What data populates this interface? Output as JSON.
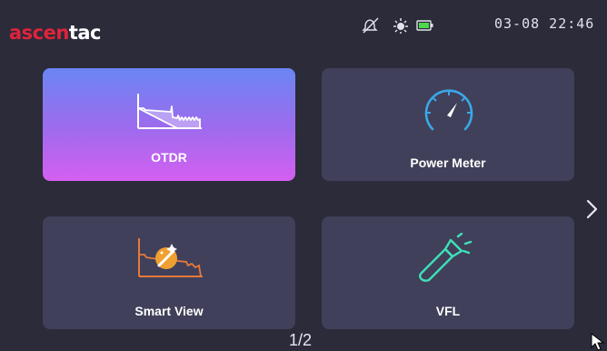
{
  "header": {
    "logo_part1": "ascen",
    "logo_part2": "tac",
    "datetime": "03-08 22:46",
    "icons": [
      "mute-icon",
      "brightness-icon",
      "battery-icon"
    ]
  },
  "tiles": [
    {
      "label": "OTDR",
      "icon": "otdr-trace-icon",
      "selected": true
    },
    {
      "label": "Power Meter",
      "icon": "gauge-icon",
      "selected": false
    },
    {
      "label": "Smart View",
      "icon": "smart-view-icon",
      "selected": false
    },
    {
      "label": "VFL",
      "icon": "flashlight-icon",
      "selected": false
    }
  ],
  "pagination": {
    "indicator": "1/2",
    "next_icon": "chevron-right-icon"
  },
  "colors": {
    "background": "#2b2b3a",
    "tile": "#40405a",
    "accent_red": "#e0233a",
    "power_meter_blue": "#3aa8e8",
    "smart_view_orange": "#e8793a",
    "vfl_green": "#3fe0b8"
  }
}
